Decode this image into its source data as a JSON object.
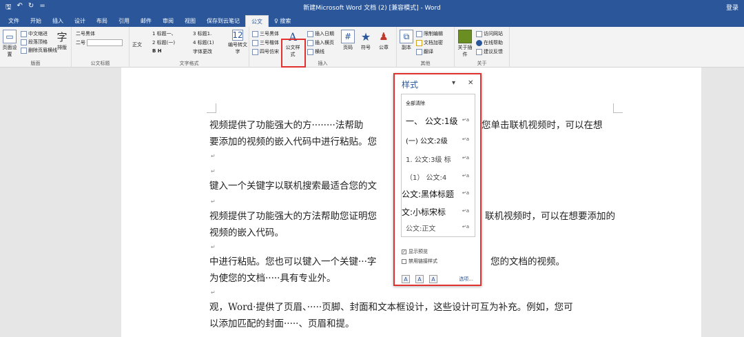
{
  "title_bar": {
    "title": "新建Microsoft Word 文档 (2) [兼容模式] - Word",
    "login": "登录",
    "qat": [
      "🖫",
      "↶",
      "↻",
      "="
    ]
  },
  "tabs": [
    "文件",
    "开始",
    "插入",
    "设计",
    "布局",
    "引用",
    "邮件",
    "审阅",
    "视图",
    "保存到云笔记",
    "公文",
    "♀ 搜索"
  ],
  "active_tab": "公文",
  "ribbon": {
    "g1": {
      "page_setup": "页面设置",
      "items": [
        "中文缩进",
        "段落顶格",
        "删除页眉横线"
      ],
      "typeset": "排版",
      "label": "版面"
    },
    "g2": {
      "font_name": "二号黑体",
      "size": "二号",
      "label": "公文标题"
    },
    "g3": {
      "zheng": "正文",
      "lines": [
        "1 标题一、",
        "2 标题(一)",
        "B H",
        "3 标题1.",
        "4 标题(1)",
        "字体更改"
      ],
      "number_convert": "编号转文字",
      "label": "文字格式"
    },
    "g4": {
      "fonts": [
        "三号黑体",
        "三号楷体",
        "四号仿宋"
      ],
      "styles_btn": "公文样式",
      "insert": [
        "插入日期",
        "插入横页",
        "横线"
      ],
      "page_no": "页码",
      "symbol": "符号",
      "seal": "公章",
      "label": "插入"
    },
    "g5": {
      "copy": "副本",
      "items": [
        "限制编辑",
        "文档加密",
        "翻译"
      ],
      "label": "其他"
    },
    "g6": {
      "about_plugin": "关于插件",
      "items": [
        "访问网站",
        "在线帮助",
        "建议反馈"
      ],
      "label": "关于"
    }
  },
  "document": {
    "paragraphs": [
      "视频提供了功能强大的方········法帮助",
      "要添加的视频的嵌入代码中进行粘贴。您",
      "键入一个关键字以联机搜索最适合您的文",
      "视频提供了功能强大的方法帮助您证明您",
      "视频的嵌入代码。",
      "中进行粘贴。您也可以键入一个关键···字",
      "为使您的文档·····具有专业外。",
      "观，Word·提供了页眉、·····页脚、封面和文本框设计，这些设计可互为补充。例如，您可",
      "以添加匹配的封面·····、页眉和提。"
    ],
    "right_text": [
      "您单击联机视频时，可以在想",
      "联机视频时，可以在想要添加的",
      "您的文档的视频。"
    ],
    "para_mark": "↵"
  },
  "styles_pane": {
    "title": "样式",
    "clear_all": "全部清除",
    "items": [
      {
        "label": "一、  公文:1级",
        "mark": "↵a"
      },
      {
        "label": "(一) 公文:2级",
        "mark": "↵a"
      },
      {
        "label": "1. 公文:3级 标",
        "mark": "↵a"
      },
      {
        "label": "（1）  公文:4",
        "mark": "↵a"
      },
      {
        "label": "公文:黑体标题",
        "mark": "↵a"
      },
      {
        "label": "文:小标宋标",
        "mark": "↵a"
      },
      {
        "label": "公文:正文",
        "mark": "↵a"
      }
    ],
    "show_preview": "显示预览",
    "disable_linked": "禁用链接样式",
    "options": "选项..."
  }
}
